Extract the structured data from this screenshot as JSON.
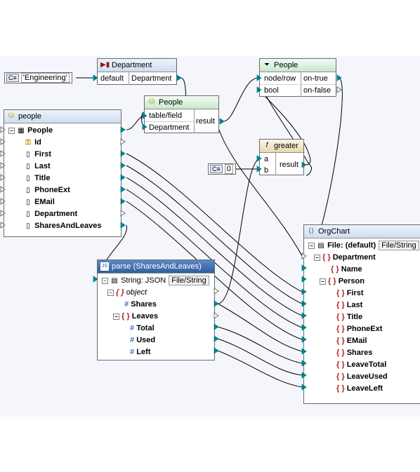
{
  "constants": {
    "engineering": {
      "icon": "C≡",
      "value": "'Engineering'"
    },
    "zero": {
      "icon": "C≡",
      "value": "0"
    }
  },
  "department_fn": {
    "title": "Department",
    "icon": "function-icon",
    "in_label": "default",
    "out_label": "Department"
  },
  "people_filter": {
    "title": "People",
    "icon": "filter-icon",
    "inputs": [
      "node/row",
      "bool"
    ],
    "outputs": [
      "on-true",
      "on-false"
    ]
  },
  "people_lookup": {
    "title": "People",
    "icon": "database-lookup-icon",
    "inputs": [
      "table/field",
      "Department"
    ],
    "output": "result"
  },
  "greater": {
    "title": "greater",
    "icon": "function-icon",
    "inputs": [
      "a",
      "b"
    ],
    "output": "result"
  },
  "people_source": {
    "title": "people",
    "icon": "database-icon",
    "table": "People",
    "fields": [
      "Id",
      "First",
      "Last",
      "Title",
      "PhoneExt",
      "EMail",
      "Department",
      "SharesAndLeaves"
    ]
  },
  "json_parse": {
    "title": "parse (SharesAndLeaves)",
    "root": "String: JSON",
    "root_tag": "File/String",
    "object": "object",
    "shares": "Shares",
    "leaves": "Leaves",
    "leaves_children": [
      "Total",
      "Used",
      "Left"
    ]
  },
  "orgchart": {
    "title": "OrgChart",
    "file": "File: (default)",
    "file_tag": "File/String",
    "department": "Department",
    "department_children": [
      "Name"
    ],
    "person": "Person",
    "person_children": [
      "First",
      "Last",
      "Title",
      "PhoneExt",
      "EMail",
      "Shares",
      "LeaveTotal",
      "LeaveUsed",
      "LeaveLeft"
    ]
  },
  "colors": {
    "canvas": "#f4f6fb",
    "connector": "#00808b",
    "wire": "#000000",
    "selected_header": "#2f5f9e"
  }
}
